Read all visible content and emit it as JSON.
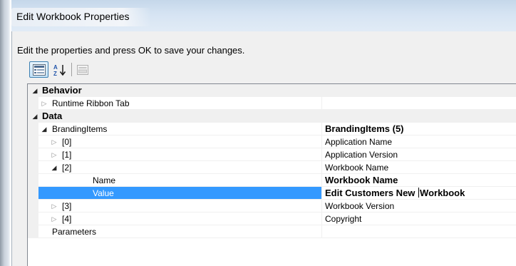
{
  "window": {
    "title": "Edit Workbook Properties"
  },
  "dialog": {
    "instruction": "Edit the properties and press OK to save your changes."
  },
  "toolbar": {
    "categorized_icon": "categorized-view-icon",
    "alphabetical_icon": "alphabetical-sort-icon",
    "property_pages_icon": "property-pages-icon",
    "alphabetical_glyph_top": "A",
    "alphabetical_glyph_bottom": "Z"
  },
  "grid": {
    "accent_color": "#3399ff",
    "rows": [
      {
        "name": "Behavior",
        "value": "",
        "type": "category",
        "state": "expanded"
      },
      {
        "name": "Runtime Ribbon Tab",
        "value": "",
        "type": "property",
        "state": "collapsed"
      },
      {
        "name": "Data",
        "value": "",
        "type": "category",
        "state": "expanded"
      },
      {
        "name": "BrandingItems",
        "value": "BrandingItems (5)",
        "type": "property",
        "state": "expanded"
      },
      {
        "name": "[0]",
        "value": "Application Name",
        "type": "item",
        "state": "collapsed"
      },
      {
        "name": "[1]",
        "value": "Application Version",
        "type": "item",
        "state": "collapsed"
      },
      {
        "name": "[2]",
        "value": "Workbook Name",
        "type": "item",
        "state": "expanded"
      },
      {
        "name": "Name",
        "value": "Workbook Name",
        "type": "subproperty"
      },
      {
        "name": "Value",
        "value_before_caret": "Edit Customers New ",
        "value_after_caret": "Workbook",
        "type": "subproperty",
        "selected": true,
        "editing": true
      },
      {
        "name": "[3]",
        "value": "Workbook Version",
        "type": "item",
        "state": "collapsed"
      },
      {
        "name": "[4]",
        "value": "Copyright",
        "type": "item",
        "state": "collapsed"
      },
      {
        "name": "Parameters",
        "value": "",
        "type": "property"
      }
    ]
  }
}
